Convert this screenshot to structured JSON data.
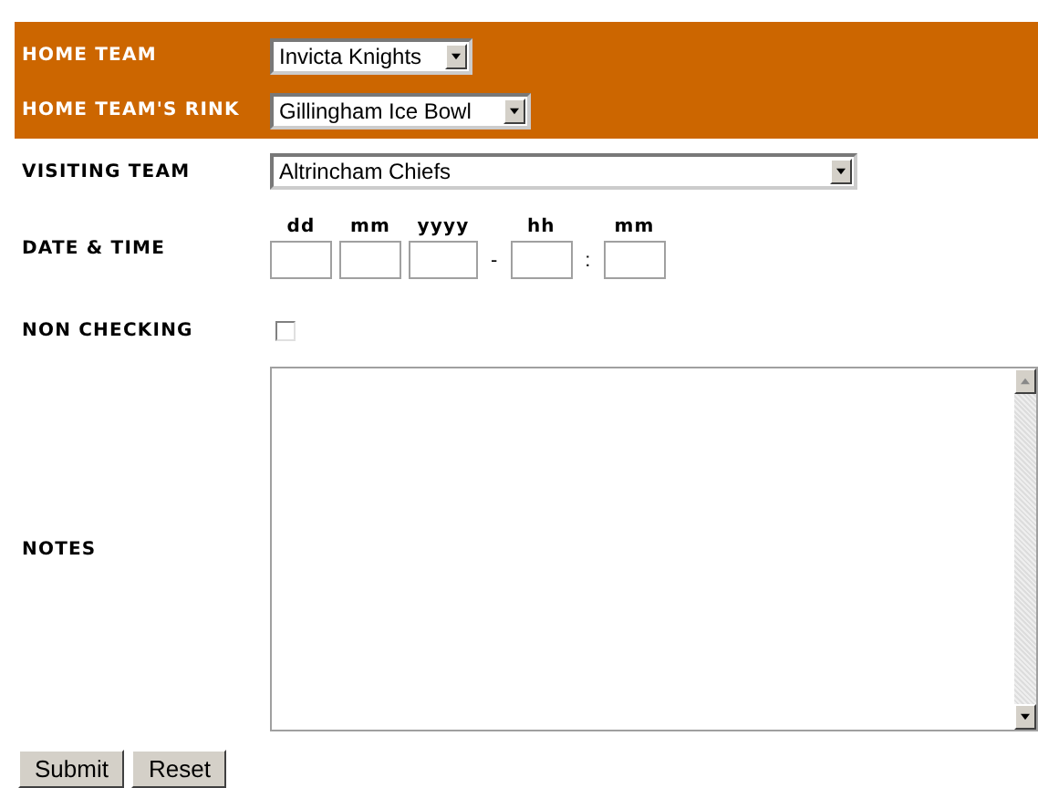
{
  "home_team": {
    "label": "HOME TEAM",
    "value": "Invicta Knights"
  },
  "home_rink": {
    "label": "HOME TEAM'S RINK",
    "value": "Gillingham Ice Bowl"
  },
  "visiting_team": {
    "label": "VISITING TEAM",
    "value": "Altrincham Chiefs"
  },
  "date_time": {
    "label": "DATE & TIME",
    "parts": [
      {
        "kind": "field",
        "label": "dd"
      },
      {
        "kind": "field",
        "label": "mm"
      },
      {
        "kind": "field",
        "label": "yyyy"
      },
      {
        "kind": "separator",
        "text": "-"
      },
      {
        "kind": "field",
        "label": "hh"
      },
      {
        "kind": "separator",
        "text": ":"
      },
      {
        "kind": "field",
        "label": "mm"
      }
    ]
  },
  "non_checking": {
    "label": "NON CHECKING",
    "checked": false
  },
  "notes": {
    "label": "NOTES"
  },
  "buttons": [
    "Submit",
    "Reset"
  ]
}
